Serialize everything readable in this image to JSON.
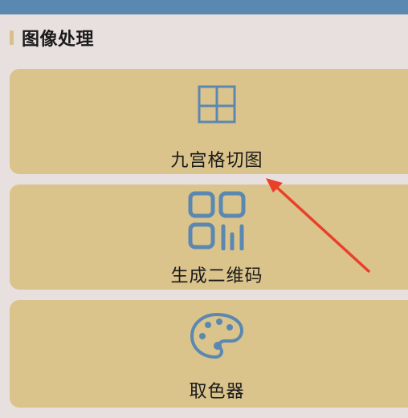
{
  "section": {
    "title": "图像处理"
  },
  "tools": [
    {
      "label": "九宫格切图",
      "icon": "nine-grid-icon"
    },
    {
      "label": "生成二维码",
      "icon": "qr-code-icon"
    },
    {
      "label": "取色器",
      "icon": "palette-icon"
    }
  ],
  "colors": {
    "top_bar": "#5b88b0",
    "background": "#e8e0de",
    "card": "#dbc38c",
    "accent": "#d8c08a",
    "icon": "#5b88b0",
    "annotation_arrow": "#e8402a"
  }
}
